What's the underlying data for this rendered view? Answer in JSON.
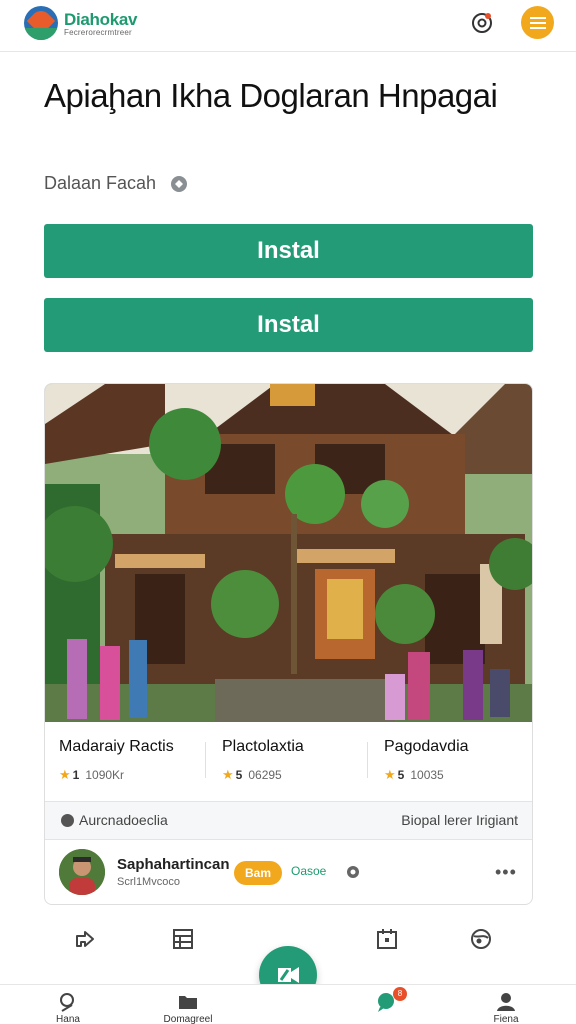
{
  "header": {
    "brand": "Diahokav",
    "brand_sub": "Fecrerorecrmtreer",
    "accent_color": "#249b77",
    "highlight_color": "#f2a81c"
  },
  "page": {
    "title": "Apiaḩan Ikha Doglaran Hnpagai",
    "subtitle": "Dalaan Facah"
  },
  "buttons": {
    "install_1": "Instal",
    "install_2": "Instal"
  },
  "card": {
    "stats": [
      {
        "name": "Madaraiy Ractis",
        "score": "1",
        "meta": "1090Kr"
      },
      {
        "name": "Plactolaxtia",
        "score": "5",
        "meta": "06295"
      },
      {
        "name": "Pagodavdia",
        "score": "5",
        "meta": "10035"
      }
    ],
    "strip_left": "Aurcnadoeclia",
    "strip_right": "Biopal lerer Irigiant",
    "user": {
      "name": "Saphahartincan",
      "sub": "Scrl1Mvcoco",
      "badge": "Bam",
      "link": "Oasoe"
    }
  },
  "bottom_nav": [
    {
      "label": "Hana",
      "icon": "search-icon"
    },
    {
      "label": "Domagreel",
      "icon": "folder-icon"
    },
    {
      "label": "",
      "icon": "chat-icon",
      "badge": "8"
    },
    {
      "label": "Fiena",
      "icon": "profile-icon"
    }
  ]
}
